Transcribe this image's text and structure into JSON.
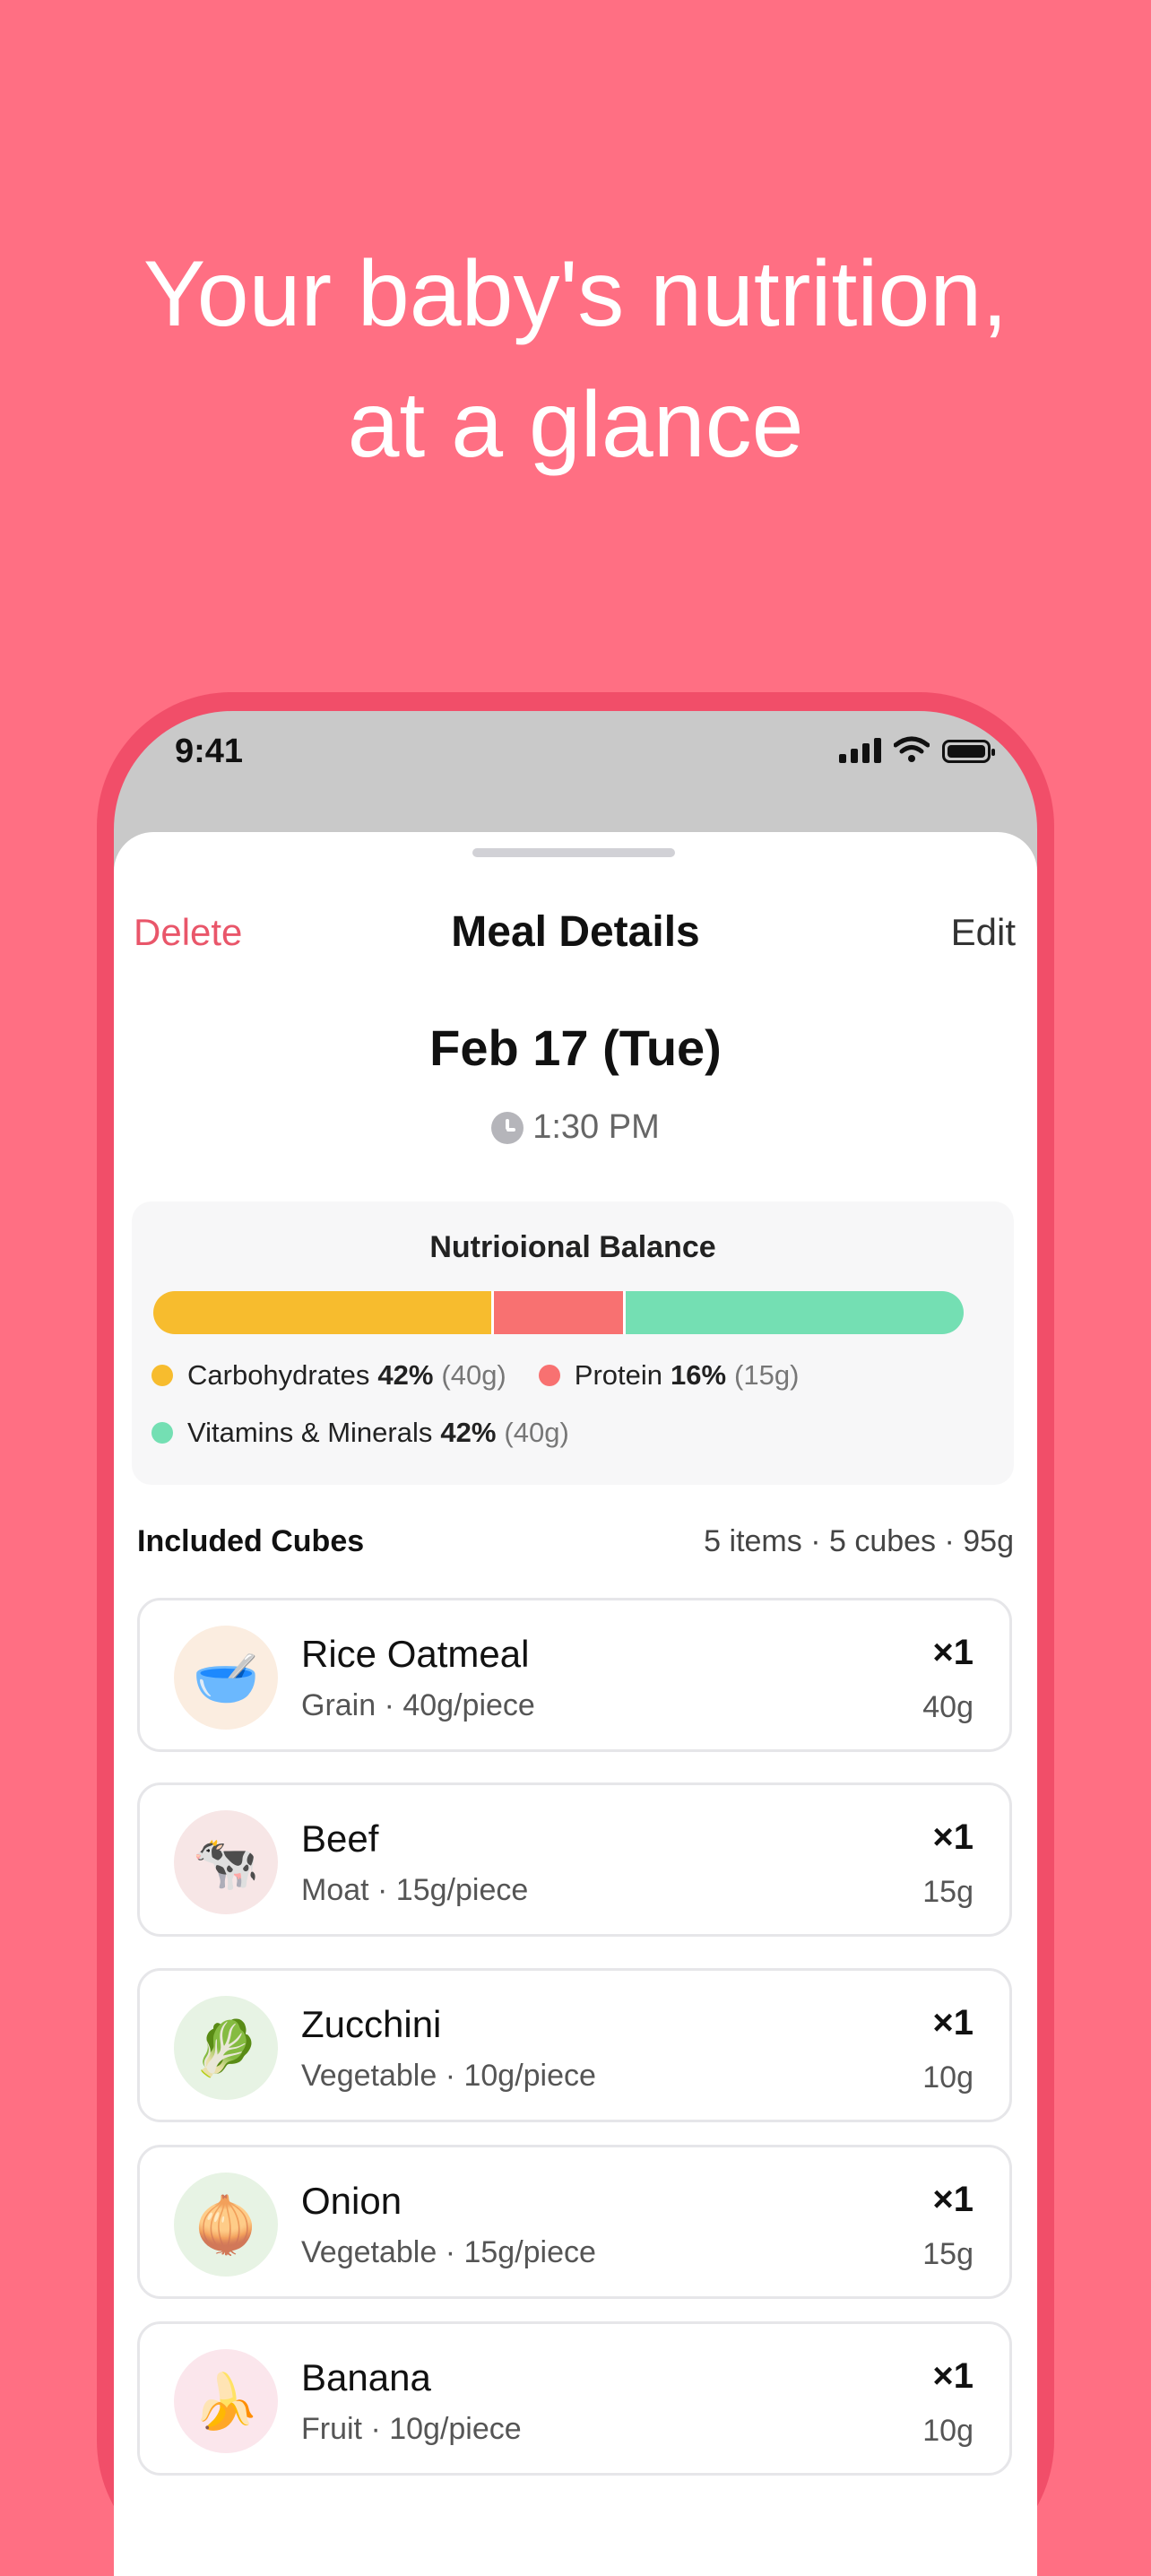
{
  "headline": [
    "Your baby's nutrition,",
    "at a glance"
  ],
  "status_bar": {
    "time": "9:41"
  },
  "nav": {
    "left": "Delete",
    "title": "Meal Details",
    "right": "Edit"
  },
  "meal": {
    "date": "Feb 17 (Tue)",
    "time": "1:30 PM"
  },
  "balance": {
    "title": "Nutrioional Balance",
    "segments": [
      {
        "name": "Carbohydrates",
        "percent_label": "42%",
        "grams": "(40g)",
        "fraction": 0.42,
        "color": "#F7BC2E"
      },
      {
        "name": "Protein",
        "percent_label": "16%",
        "grams": "(15g)",
        "fraction": 0.16,
        "color": "#F87171"
      },
      {
        "name": "Vitamins & Minerals",
        "percent_label": "42%",
        "grams": "(40g)",
        "fraction": 0.42,
        "color": "#74DFB3"
      }
    ]
  },
  "cubes": {
    "label": "Included Cubes",
    "summary": "5 items · 5 cubes · 95g",
    "items": [
      {
        "name": "Rice Oatmeal",
        "meta": "Grain · 40g/piece",
        "qty": "×1",
        "weight": "40g",
        "emoji": "🥣",
        "bg": "#FBEDE0",
        "icon": "porridge-bowl-icon"
      },
      {
        "name": "Beef",
        "meta": "Moat · 15g/piece",
        "qty": "×1",
        "weight": "15g",
        "emoji": "🐄",
        "bg": "#F7E6E6",
        "icon": "cow-icon"
      },
      {
        "name": "Zucchini",
        "meta": "Vegetable · 10g/piece",
        "qty": "×1",
        "weight": "10g",
        "emoji": "🥬",
        "bg": "#E7F3E4",
        "icon": "leafy-green-icon"
      },
      {
        "name": "Onion",
        "meta": "Vegetable · 15g/piece",
        "qty": "×1",
        "weight": "15g",
        "emoji": "🧅",
        "bg": "#E7F3E4",
        "icon": "onion-icon"
      },
      {
        "name": "Banana",
        "meta": "Fruit · 10g/piece",
        "qty": "×1",
        "weight": "10g",
        "emoji": "🍌",
        "bg": "#FBE6EC",
        "icon": "banana-icon"
      }
    ]
  },
  "colors": {
    "background": "#FF6F83",
    "phone_frame": "#F14E69",
    "delete": "#E9566A"
  }
}
